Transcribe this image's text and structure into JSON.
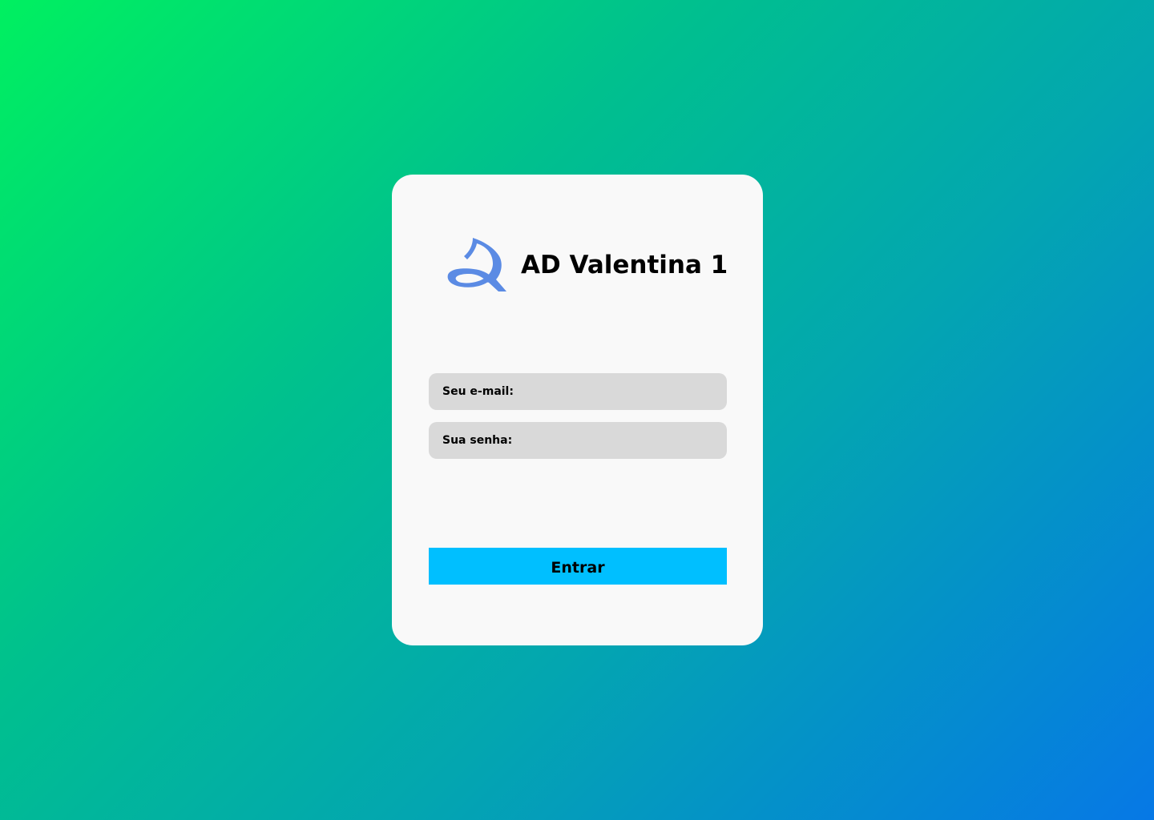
{
  "brand": {
    "title": "AD Valentina 1",
    "logo_icon": "ribbon-sail-logo-icon",
    "logo_color": "#5b8be4"
  },
  "form": {
    "email_placeholder": "Seu e-mail:",
    "email_value": "",
    "password_placeholder": "Sua senha:",
    "password_value": "",
    "submit_label": "Entrar"
  },
  "colors": {
    "background_start": "#00f060",
    "background_end": "#0678e6",
    "card": "#f9f9f9",
    "field": "#d9d9d9",
    "button": "#00bfff"
  }
}
